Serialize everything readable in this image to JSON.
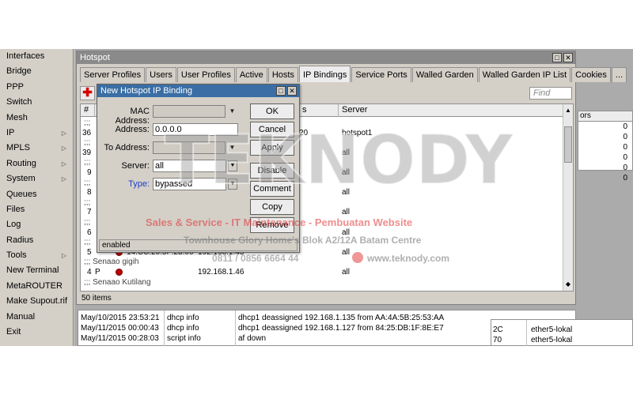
{
  "menu": [
    {
      "label": "Interfaces",
      "arrow": false
    },
    {
      "label": "Bridge",
      "arrow": false
    },
    {
      "label": "PPP",
      "arrow": false
    },
    {
      "label": "Switch",
      "arrow": false
    },
    {
      "label": "Mesh",
      "arrow": false
    },
    {
      "label": "IP",
      "arrow": true
    },
    {
      "label": "MPLS",
      "arrow": true
    },
    {
      "label": "Routing",
      "arrow": true
    },
    {
      "label": "System",
      "arrow": true
    },
    {
      "label": "Queues",
      "arrow": false
    },
    {
      "label": "Files",
      "arrow": false
    },
    {
      "label": "Log",
      "arrow": false
    },
    {
      "label": "Radius",
      "arrow": false
    },
    {
      "label": "Tools",
      "arrow": true
    },
    {
      "label": "New Terminal",
      "arrow": false
    },
    {
      "label": "MetaROUTER",
      "arrow": false
    },
    {
      "label": "Make Supout.rif",
      "arrow": false
    },
    {
      "label": "Manual",
      "arrow": false
    },
    {
      "label": "Exit",
      "arrow": false
    }
  ],
  "hotspot": {
    "title": "Hotspot",
    "tabs": [
      "Server Profiles",
      "Users",
      "User Profiles",
      "Active",
      "Hosts",
      "IP Bindings",
      "Service Ports",
      "Walled Garden",
      "Walled Garden IP List",
      "Cookies",
      "..."
    ],
    "active_tab": "IP Bindings",
    "find_placeholder": "Find",
    "columns": {
      "num": "#",
      "to_address": "s",
      "server": "Server"
    },
    "rows": [
      {
        "comment": ";;;"
      },
      {
        "num": "36",
        "to": "20",
        "server": "hotspot1"
      },
      {
        "comment": ";;;"
      },
      {
        "num": "39",
        "server": "all"
      },
      {
        "comment": ";;;"
      },
      {
        "num": "9",
        "server": "all"
      },
      {
        "comment": ";;;"
      },
      {
        "num": "8",
        "server": "all"
      },
      {
        "comment": ";;;"
      },
      {
        "num": "7",
        "server": "all"
      },
      {
        "comment": ";;;"
      },
      {
        "num": "6",
        "server": "all"
      },
      {
        "comment": ";;;"
      },
      {
        "num": "5",
        "mac": "14:CC:20:5F:23:06",
        "addr": "192.168.1.45",
        "server": "all"
      },
      {
        "comment": ";;; Senaao gigih"
      },
      {
        "num": "4",
        "type": "P",
        "addr": "192.168.1.46",
        "server": "all"
      },
      {
        "comment": ";;; Senaao Kutilang"
      }
    ],
    "status": "50 items"
  },
  "right_panel": {
    "header": "ors",
    "values": [
      "0",
      "0",
      "0",
      "0",
      "0",
      "0"
    ]
  },
  "log": {
    "rows": [
      {
        "time": "May/10/2015 23:53:21",
        "topic": "dhcp info",
        "message": "dhcp1 deassigned 192.168.1.135 from AA:4A:5B:25:53:AA"
      },
      {
        "time": "May/11/2015 00:00:43",
        "topic": "dhcp info",
        "message": "dhcp1 deassigned 192.168.1.127 from 84:25:DB:1F:8E:E7"
      },
      {
        "time": "May/11/2015 00:28:03",
        "topic": "script info",
        "message": "af down"
      }
    ],
    "side_rows": [
      {
        "a": "2C",
        "b": "ether5-lokal"
      },
      {
        "a": "70",
        "b": "ether5-lokal"
      }
    ]
  },
  "dialog": {
    "title": "New Hotspot IP Binding",
    "mac_label": "MAC Address:",
    "mac_value": "",
    "address_label": "Address:",
    "address_value": "0.0.0.0",
    "to_address_label": "To Address:",
    "to_address_value": "",
    "server_label": "Server:",
    "server_value": "all",
    "type_label": "Type:",
    "type_value": "bypassed",
    "buttons": {
      "ok": "OK",
      "cancel": "Cancel",
      "apply": "Apply",
      "disable": "Disable",
      "comment": "Comment",
      "copy": "Copy",
      "remove": "Remove"
    },
    "status": "enabled"
  },
  "watermark": {
    "brand": "TEKNODY",
    "tagline": "Sales & Service - IT Maintenance - Pembuatan Website",
    "address": "Townhouse Glory Home's Blok A2/12A Batam Centre",
    "phone": "0811 / 0856 6664 44",
    "website": "www.teknody.com"
  }
}
